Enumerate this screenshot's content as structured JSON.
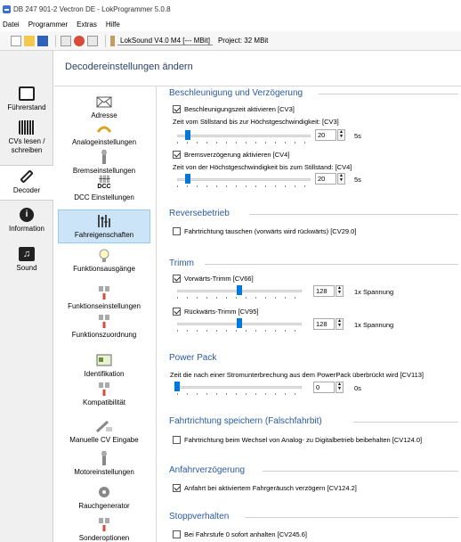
{
  "window": {
    "title": "DB 247 901-2 Vectron DE - LokProgrammer 5.0.8"
  },
  "menu": [
    "Datei",
    "Programmer",
    "Extras",
    "Hilfe"
  ],
  "toolbar": {
    "decoder_select": "LokSound V4.0 M4 [--- MBit]",
    "project": "Project: 32 MBit"
  },
  "nav": {
    "items": [
      {
        "label": "Führerstand",
        "icon": "cab-icon"
      },
      {
        "label": "CVs lesen / schreiben",
        "icon": "cv-icon"
      },
      {
        "label": "Decoder",
        "icon": "wrench-icon"
      },
      {
        "label": "Information",
        "icon": "info-icon"
      },
      {
        "label": "Sound",
        "icon": "music-icon"
      }
    ],
    "selected": "Decoder"
  },
  "header": {
    "title": "Decodereinstellungen ändern"
  },
  "categories": [
    {
      "label": "Adresse",
      "icon": "envelope-icon"
    },
    {
      "label": "Analogeinstellungen",
      "icon": "analog-icon"
    },
    {
      "label": "Bremseinstellungen",
      "icon": "brake-icon"
    },
    {
      "label": "DCC Einstellungen",
      "icon": "dcc-icon",
      "icon_text": "DCC"
    },
    {
      "label": "Fahreigenschaften",
      "icon": "drive-icon"
    },
    {
      "label": "Funktionsausgänge",
      "icon": "bulb-icon"
    },
    {
      "label": "Funktionseinstellungen",
      "icon": "function-icon"
    },
    {
      "label": "Funktionszuordnung",
      "icon": "mapping-icon"
    },
    {
      "label": "Identifikation",
      "icon": "id-card-icon"
    },
    {
      "label": "Kompatibilität",
      "icon": "compat-icon"
    },
    {
      "label": "Manuelle CV Eingabe",
      "icon": "manual-cv-icon"
    },
    {
      "label": "Motoreinstellungen",
      "icon": "motor-icon"
    },
    {
      "label": "Rauchgenerator",
      "icon": "smoke-icon"
    },
    {
      "label": "Sonderoptionen",
      "icon": "special-icon"
    }
  ],
  "selected_category": "Fahreigenschaften",
  "sections": {
    "accel": {
      "title": "Beschleunigung und Verzögerung",
      "accel_cb": "Beschleunigungszeit aktivieren [CV3]",
      "accel_desc": "Zeit vom Stillstand bis zur Höchstgeschwindigkeit: [CV3]",
      "accel_value": "20",
      "accel_unit": "5s",
      "accel_level": 0.08,
      "decel_cb": "Bremsverzögerung aktivieren [CV4]",
      "decel_desc": "Zeit von der Höchstgeschwindigkeit bis zum Stillstand: [CV4]",
      "decel_value": "20",
      "decel_unit": "5s",
      "decel_level": 0.08
    },
    "reverse": {
      "title": "Reversebetrieb",
      "cb": "Fahrtrichtung tauschen (vorwärts wird rückwärts) [CV29.0]"
    },
    "trim": {
      "title": "Trimm",
      "fwd_cb": "Vorwärts-Trimm [CV66]",
      "fwd_value": "128",
      "fwd_unit": "1x Spannung",
      "fwd_level": 0.5,
      "rev_cb": "Rückwärts-Trimm [CV95]",
      "rev_value": "128",
      "rev_unit": "1x Spannung",
      "rev_level": 0.5
    },
    "powerpack": {
      "title": "Power Pack",
      "desc": "Zeit die nach einer Stromunterbrechung aus dem PowerPack überbrückt wird [CV113]",
      "value": "0",
      "unit": "0s",
      "level": 0.0
    },
    "direction": {
      "title": "Fahrtrichtung speichern (Falschfahrbit)",
      "cb": "Fahrtrichtung beim Wechsel von Analog- zu Digitalbetrieb beibehalten [CV124.0]"
    },
    "startdelay": {
      "title": "Anfahrverzögerung",
      "cb": "Anfahrt bei aktiviertem Fahrgeräusch verzögern [CV124.2]"
    },
    "stop": {
      "title": "Stoppverhalten",
      "cb": "Bei Fahrstufe 0 sofort anhalten [CV245.6]"
    }
  }
}
